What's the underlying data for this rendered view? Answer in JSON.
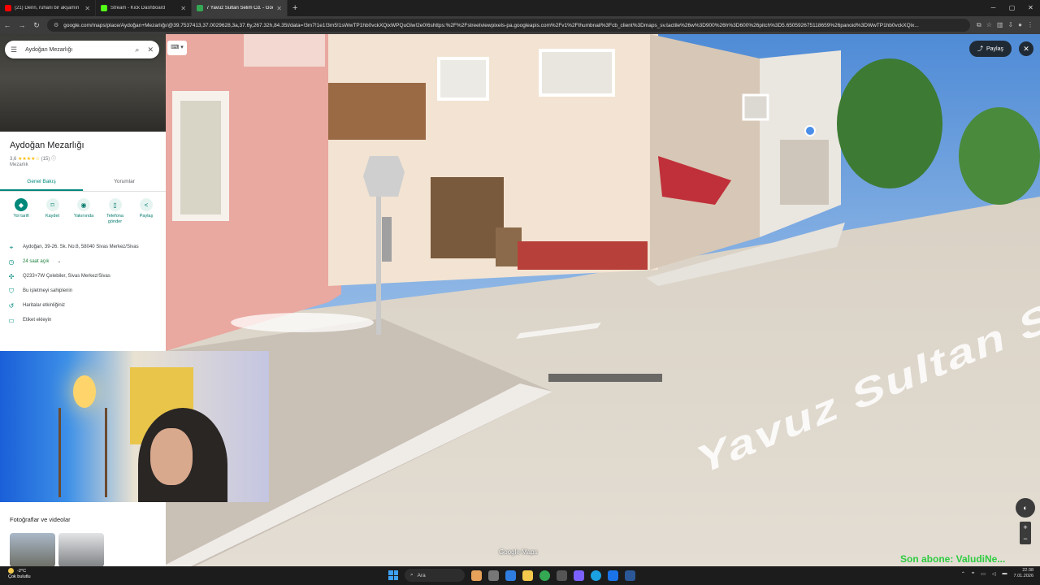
{
  "tabs": [
    {
      "label": "(21) Derin, ruhani bir akşamın",
      "color": "#ff0000"
    },
    {
      "label": "Stream - Kick Dashboard",
      "color": "#53fc18"
    },
    {
      "label": "7 Yavuz Sultan Selim Cd. - Goo",
      "color": "#34a853"
    }
  ],
  "address": {
    "url": "google.com/maps/place/Aydoğan+Mezarlığı/@39.7537413,37.0029628,3a,37.6y,267.32h,84.35t/data=!3m7!1e1!3m5!1sWwTP1hb0vckXQixWPQuGlw!2e0!6shttps:%2F%2Fstreetviewpixels-pa.googleapis.com%2Fv1%2Fthumbnail%3Fcb_client%3Dmaps_sv.tactile%26w%3D900%26h%3D600%26pitch%3D5.650592675118659%26panoid%3DWwTP1hb0vckXQix..."
  },
  "search": {
    "value": "Aydoğan Mezarlığı"
  },
  "place": {
    "title": "Aydoğan Mezarlığı",
    "rating": "3,6",
    "stars": "★★★★☆",
    "reviews": "(15)",
    "category": "Mezarlık"
  },
  "panel_tabs": [
    "Genel Bakış",
    "Yorumlar"
  ],
  "actions": [
    {
      "label": "Yol tarifi",
      "icon": "◆"
    },
    {
      "label": "Kaydet",
      "icon": "▯"
    },
    {
      "label": "Yakınında",
      "icon": "◉"
    },
    {
      "label": "Telefona gönder",
      "icon": "▯"
    },
    {
      "label": "Paylaş",
      "icon": "<"
    }
  ],
  "info": {
    "address": "Aydoğan, 39-26. Sk. No:8, 58040 Sivas Merkez/Sivas",
    "hours": "24 saat açık",
    "pluscode": "Q233+7W Çelebiler, Sivas Merkez/Sivas",
    "claim": "Bu işletmeyi sahiplenin",
    "activity": "Haritalar etkinliğiniz",
    "label": "Etiket ekleyin"
  },
  "photos_heading": "Fotoğraflar ve videolar",
  "overlay": {
    "share": "Paylaş",
    "google_maps": "Google Maps",
    "street_name": "Yavuz Sultan Selim",
    "watermark": "Son abone: ValudiNe..."
  },
  "taskbar": {
    "weather_temp": "-2°C",
    "weather_text": "Çok bulutlu",
    "search": "Ara",
    "time": "22:38",
    "date": "7.01.2026"
  }
}
